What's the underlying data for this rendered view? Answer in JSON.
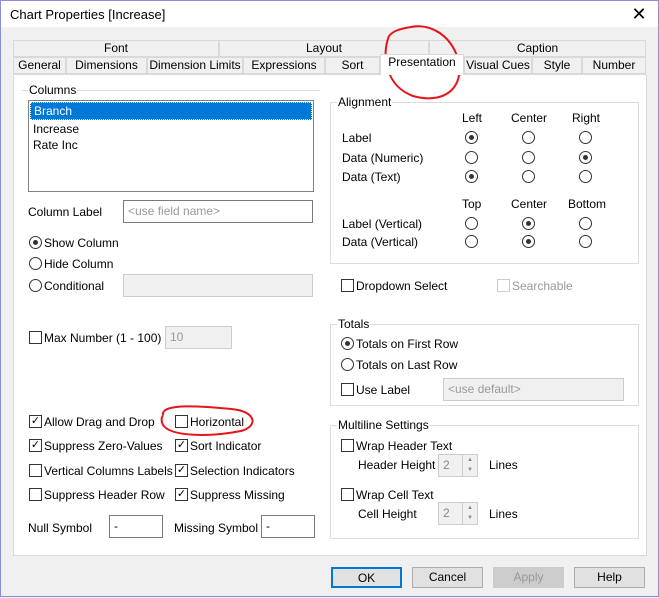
{
  "window": {
    "title": "Chart Properties [Increase]",
    "close": "✕"
  },
  "tabs_row1": [
    "Font",
    "Layout",
    "Caption"
  ],
  "tabs_row2": [
    "General",
    "Dimensions",
    "Dimension Limits",
    "Expressions",
    "Sort",
    "Presentation",
    "Visual Cues",
    "Style",
    "Number"
  ],
  "columns": {
    "label": "Columns",
    "items": [
      "Branch",
      "Increase",
      "Rate Inc"
    ],
    "selected": "Branch",
    "column_label": "Column Label",
    "column_label_placeholder": "<use field name>",
    "show": "Show Column",
    "hide": "Hide Column",
    "conditional": "Conditional"
  },
  "alignment": {
    "label": "Alignment",
    "h_headers": [
      "Left",
      "Center",
      "Right"
    ],
    "v_headers": [
      "Top",
      "Center",
      "Bottom"
    ],
    "rows": [
      "Label",
      "Data (Numeric)",
      "Data (Text)"
    ],
    "vrows": [
      "Label (Vertical)",
      "Data (Vertical)"
    ],
    "dropdown_select": "Dropdown Select",
    "searchable": "Searchable"
  },
  "max_number": {
    "label": "Max Number (1 - 100)",
    "value": "10"
  },
  "totals": {
    "label": "Totals",
    "first": "Totals on First Row",
    "last": "Totals on Last Row",
    "use_label": "Use Label",
    "placeholder": "<use default>"
  },
  "options": {
    "allow_drag": "Allow Drag and Drop",
    "horizontal": "Horizontal",
    "suppress_zero": "Suppress Zero-Values",
    "sort_indicator": "Sort Indicator",
    "vertical_labels": "Vertical Columns Labels",
    "selection_indicators": "Selection Indicators",
    "suppress_header": "Suppress Header Row",
    "suppress_missing": "Suppress Missing",
    "null_symbol": "Null Symbol",
    "null_value": "-",
    "missing_symbol": "Missing Symbol",
    "missing_value": "-"
  },
  "multiline": {
    "label": "Multiline Settings",
    "wrap_header": "Wrap Header Text",
    "header_height": "Header Height",
    "header_value": "2",
    "wrap_cell": "Wrap Cell Text",
    "cell_height": "Cell Height",
    "cell_value": "2",
    "lines": "Lines"
  },
  "buttons": {
    "ok": "OK",
    "cancel": "Cancel",
    "apply": "Apply",
    "help": "Help"
  },
  "annotation_color": "#e8141b"
}
